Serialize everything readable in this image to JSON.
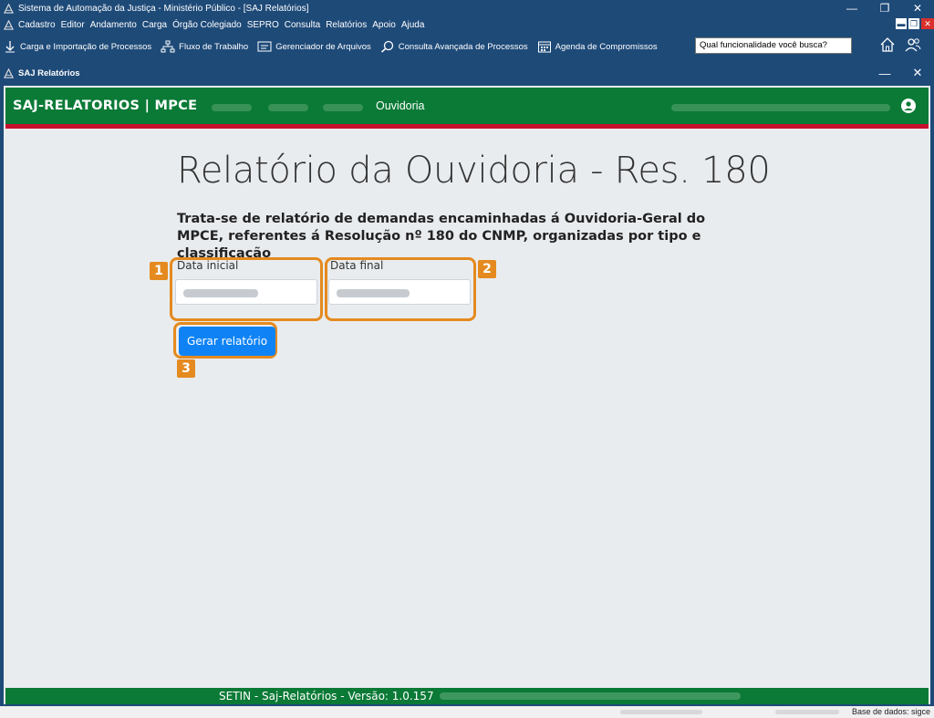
{
  "app": {
    "title": "Sistema de Automação da Justiça - Ministério Público - [SAJ Relatórios]",
    "controls": [
      "—",
      "❐",
      "✕"
    ]
  },
  "menu": {
    "items": [
      "Cadastro",
      "Editor",
      "Andamento",
      "Carga",
      "Órgão Colegiado",
      "SEPRO",
      "Consulta",
      "Relatórios",
      "Apoio",
      "Ajuda"
    ]
  },
  "toolbar": {
    "items": [
      {
        "label": "Carga e Importação de Processos",
        "icon": "download-arrow-icon"
      },
      {
        "label": "Fluxo de Trabalho",
        "icon": "workflow-icon"
      },
      {
        "label": "Gerenciador de Arquivos",
        "icon": "file-manager-icon"
      },
      {
        "label": "Consulta Avançada de Processos",
        "icon": "search-process-icon"
      },
      {
        "label": "Agenda de Compromissos",
        "icon": "calendar-icon"
      }
    ],
    "search_placeholder": "Qual funcionalidade você busca?"
  },
  "inner_window": {
    "title": "SAJ Relatórios"
  },
  "navbar": {
    "brand": "SAJ-RELATORIOS | MPCE",
    "active_link": "Ouvidoria"
  },
  "page": {
    "title": "Relatório da Ouvidoria - Res. 180",
    "description": "Trata-se de relatório de demandas encaminhadas á Ouvidoria-Geral do MPCE, referentes á Resolução nº 180 do CNMP, organizadas por tipo e classificação",
    "fields": {
      "start_label": "Data inicial",
      "end_label": "Data final"
    },
    "generate_button": "Gerar relatório",
    "badges": [
      "1",
      "2",
      "3"
    ]
  },
  "footer": {
    "text": "SETIN - Saj-Relatórios - Versão: 1.0.157"
  },
  "status": {
    "database": "Base de dados: sigce"
  },
  "colors": {
    "chrome_blue": "#1e4a78",
    "nav_green": "#0a7a36",
    "accent_red": "#c8102e",
    "highlight_orange": "#e58a1f",
    "button_blue": "#0f83f5"
  }
}
